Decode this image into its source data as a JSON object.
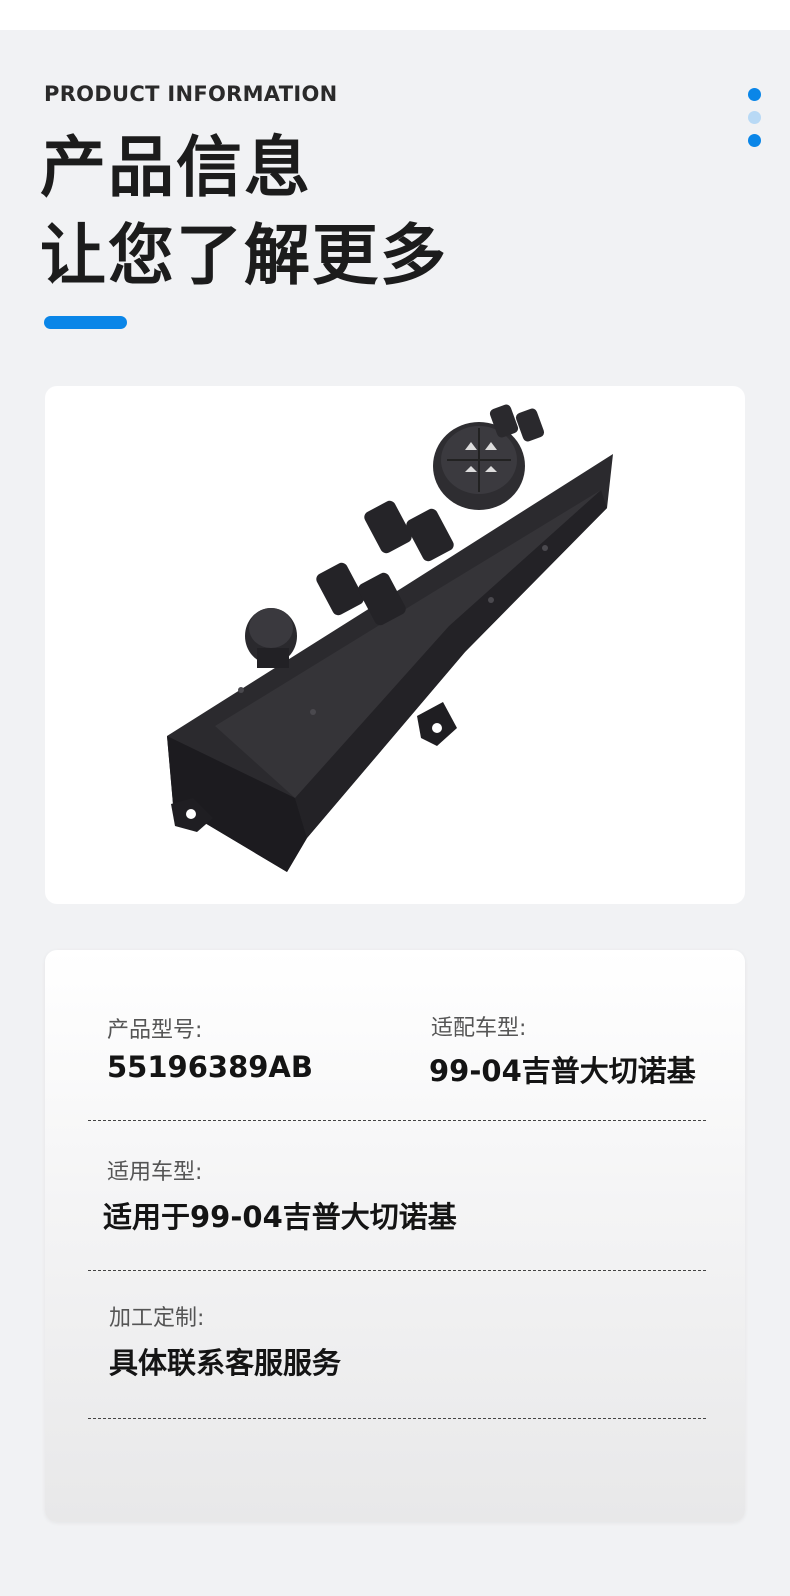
{
  "header": {
    "eyebrow": "PRODUCT INFORMATION",
    "title_line1": "产品信息",
    "title_line2": "让您了解更多",
    "accent_color": "#0a86e8"
  },
  "pager": {
    "count": 3,
    "active_index": 0
  },
  "product_image": {
    "icon": "car-seat-power-switch-image"
  },
  "specs": {
    "model_label": "产品型号:",
    "model_value": "55196389AB",
    "fit_label": "适配车型:",
    "fit_value": "99-04吉普大切诺基",
    "applicable_label": "适用车型:",
    "applicable_value": "适用于99-04吉普大切诺基",
    "custom_label": "加工定制:",
    "custom_value": "具体联系客服服务"
  }
}
